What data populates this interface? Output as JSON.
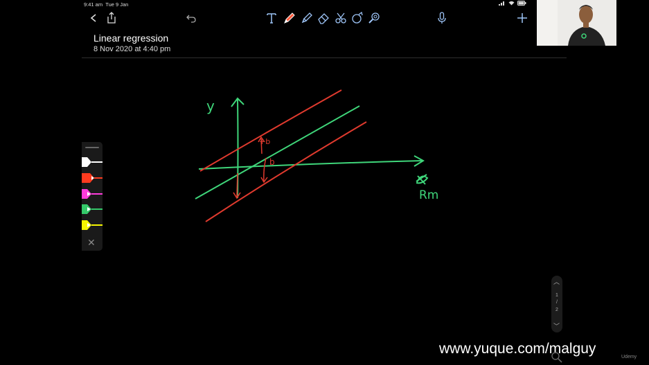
{
  "status_bar": {
    "time": "9:41 am",
    "date": "Tue 9 Jan"
  },
  "toolbar": {
    "left_icons": [
      "back-icon",
      "share-icon",
      "undo-icon"
    ],
    "tools": [
      "text-tool-icon",
      "pen-tool-icon",
      "highlighter-tool-icon",
      "eraser-tool-icon",
      "lasso-tool-icon",
      "shapes-tool-icon",
      "zoom-tool-icon"
    ],
    "right_icons": [
      "microphone-icon",
      "add-icon"
    ],
    "active_tool_color": "#ff5a3c"
  },
  "document": {
    "title": "Linear regression",
    "date": "8 Nov 2020 at 4:40 pm"
  },
  "palette": {
    "colors": [
      "#ffffff",
      "#ff3b1f",
      "#ff3bdc",
      "#34c96a",
      "#f5f500"
    ],
    "close_icon": "close-icon"
  },
  "drawing": {
    "y_axis_label": "y",
    "x_axis_label": "Rm",
    "margin_labels": [
      "+b",
      "b"
    ],
    "colors": {
      "axes": "#3fd67a",
      "regression_line": "#3fd67a",
      "bands": "#e03a2e"
    }
  },
  "pager": {
    "pages": [
      "1",
      "2"
    ]
  },
  "watermark": "www.yuque.com/malguy",
  "udemy_badge": "Udemy"
}
